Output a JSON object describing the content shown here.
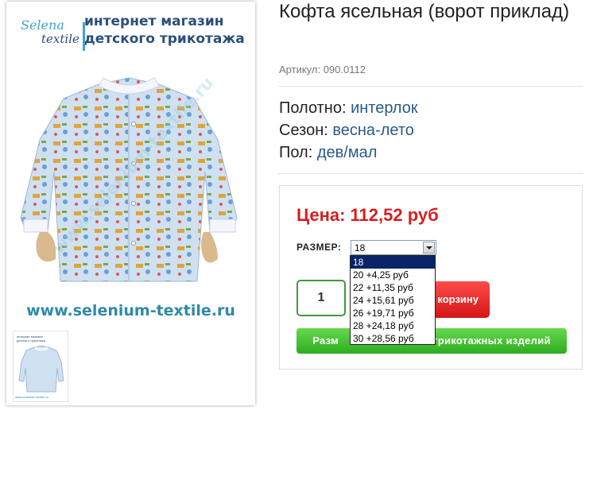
{
  "brand": {
    "logo_top": "Selena",
    "logo_bottom": "textile",
    "headline_line1": "интернет магазин",
    "headline_line2": "детского трикотажа",
    "watermark": "www.selenium-textile.ru",
    "url": "www.selenium-textile.ru",
    "thumb_url": "www.selenium-textile.ru",
    "thumb_head1": "интернет магазин",
    "thumb_head2": "детского трикотажа"
  },
  "product": {
    "title": "Кофта ясельная (ворот приклад)",
    "sku": "Артикул: 090.0112",
    "attributes": [
      {
        "label": "Полотно:",
        "value": "интерлок"
      },
      {
        "label": "Сезон:",
        "value": "весна-лето"
      },
      {
        "label": "Пол:",
        "value": "дев/мал"
      }
    ]
  },
  "buy_box": {
    "price": "Цена: 112,52 руб",
    "size_label": "РАЗМЕР:",
    "size_selected": "18",
    "size_options": [
      "18",
      "20 +4,25 руб",
      "22 +11,35 руб",
      "24 +15,61 руб",
      "26 +19,71 руб",
      "28 +24,18 руб",
      "30 +28,56 руб"
    ],
    "quantity": "1",
    "cart_button_visible_text": "корзину",
    "size_table_button_left": "Разм",
    "size_table_button_right": "трикотажных изделий"
  },
  "colors": {
    "price_red": "#d61f1f",
    "value_blue": "#2a5a8a",
    "cart_red": "#e02525",
    "green_button": "#3cba2a",
    "dropdown_highlight": "#0a246a"
  }
}
